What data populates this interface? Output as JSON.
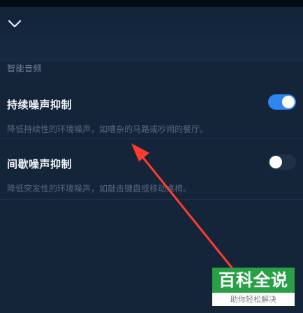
{
  "header": {
    "back_icon": "chevron-down-icon"
  },
  "section": {
    "title": "智能音频"
  },
  "settings": [
    {
      "title": "持续噪声抑制",
      "description": "降低持续性的环境噪声，如嘈杂的马路或吵闹的餐厅。",
      "enabled": true
    },
    {
      "title": "间歇噪声抑制",
      "description": "降低突发性的环境噪声，如敲击键盘或移动桌椅。",
      "enabled": false
    }
  ],
  "watermark": {
    "brand": "百科全说",
    "slogan": "助你轻松解决"
  },
  "colors": {
    "background": "#14253a",
    "switch_on": "#2f86f2",
    "arrow": "#ff3b30",
    "watermark_green": "#2aa046"
  }
}
